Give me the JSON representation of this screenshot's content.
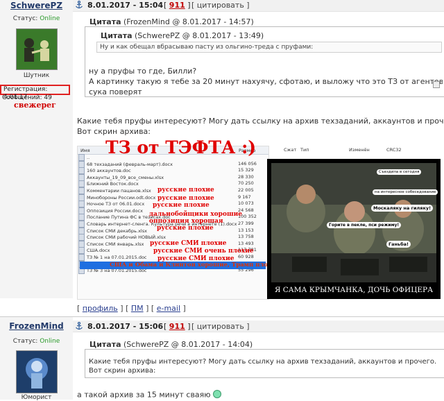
{
  "post1": {
    "username": "SchwerePZ",
    "status_label": "Статус:",
    "status_value": "Online",
    "rank": "Шутник",
    "reg_label": "Регистрация: 4.01.17",
    "messages_label": "Сообщений: 49",
    "badge": "свежерег",
    "date": "8.01.2017 - 15:04",
    "open_bracket": "[",
    "post_number": "911",
    "close_bracket": "]",
    "quote_action": "[ цитировать ]",
    "outer_quote": {
      "author_label": "Цитата",
      "author_meta": "(FrozenMind @ 8.01.2017 - 14:57)"
    },
    "inner_quote": {
      "author_label": "Цитата",
      "author_meta": "(SchwerePZ @ 8.01.2017 - 13:49)",
      "text": "Ну и как обещал вбрасываю пасту из ольгино-треда с пруфами:"
    },
    "outer_quote_lines": [
      "ну а пруфы то где, Билли?",
      "А картинку такую я тебе за 20 минут нахуячу, сфотаю, и выложу что это ТЗ от агентов ЦРУ. И мне поверят.",
      "сука поверят"
    ],
    "body_lines": [
      "Какие тебя пруфы интересуют? Могу дать ссылку на архив техзаданий, аккаунтов и прочего.",
      "Вот скрин архива:"
    ],
    "footer": {
      "profile": "профиль",
      "pm": "ПМ",
      "email": "e-mail"
    }
  },
  "screenshot": {
    "columns": [
      "Имя",
      "Размер",
      "Сжат",
      "Тип",
      "Изменён",
      "CRC32"
    ],
    "title_overlay": "ТЗ от ТЭФТА :)",
    "files": [
      {
        "name": "..",
        "size": ""
      },
      {
        "name": "68 техзаданий (февраль-март).docx",
        "size": "146 056"
      },
      {
        "name": "160 аккаунтов.doc",
        "size": "15 329"
      },
      {
        "name": "Аккаунты_19_09_все_смены.xlsx",
        "size": "28 330"
      },
      {
        "name": "Ближний Восток.docx",
        "size": "70 250"
      },
      {
        "name": "Комментарии пацанов.xlsx",
        "size": "22 005"
      },
      {
        "name": "Минобороны России.odt.docx",
        "size": "9 167"
      },
      {
        "name": "Ночное ТЗ от 06.01.docx",
        "size": "10 073"
      },
      {
        "name": "Оппозиция России.docx",
        "size": "24 568"
      },
      {
        "name": "Послание Путина ФС в тезисах.doc",
        "size": "100 352"
      },
      {
        "name": "Словарь интернет-сленга. Культура речи в интернете (1).docx",
        "size": "27 399"
      },
      {
        "name": "Список СМИ декабрь.xlsx",
        "size": "13 153"
      },
      {
        "name": "Список СМИ рабочий НОВЫЙ.xlsx",
        "size": "13 758"
      },
      {
        "name": "Список СМИ январь.xlsx",
        "size": "13 493"
      },
      {
        "name": "США.docx",
        "size": "117 781"
      },
      {
        "name": "ТЗ № 1 на 07.01.2015.doc",
        "size": "60 928"
      },
      {
        "name": "ТЗ № 2 на 07.01.2015.doc",
        "size": "61 952"
      },
      {
        "name": "ТЗ № 3 на 07.01.2015.doc",
        "size": "55 296"
      }
    ],
    "annotations": [
      "русские плохие",
      "русские плохие",
      "русские плохие",
      "дальнобойщики хорошие",
      "оппозиция хорошая",
      "русские плохие",
      "русские СМИ плохие",
      "русские СМИ очень плохие",
      "русские СМИ плохие",
      "США и Обама и Клинтон хорошие, Трамп плохой"
    ]
  },
  "meme": {
    "bubbles": [
      "Съездила в сегодня",
      "на интересное собеседование",
      "Москаляку на гиляку!",
      "Горите в пекле, пси режиму!",
      "Ганьба!"
    ],
    "caption": "Я САМА КРЫМЧАНКА, ДОЧЬ ОФИЦЕРА"
  },
  "post2": {
    "username": "FrozenMind",
    "status_label": "Статус:",
    "status_value": "Online",
    "rank": "Юморист",
    "date": "8.01.2017 - 15:06",
    "open_bracket": "[",
    "post_number": "911",
    "close_bracket": "]",
    "quote_action": "[ цитировать ]",
    "quote": {
      "author_label": "Цитата",
      "author_meta": "(SchwerePZ @ 8.01.2017 - 14:04)",
      "lines": [
        "Какие тебя пруфы интересуют? Могу дать ссылку на архив техзаданий, аккаунтов и прочего.",
        "Вот скрин архива:"
      ]
    },
    "body_text": "а такой архив за 15 минут сваяю"
  },
  "colors": {
    "online": "#2a9a2a",
    "link": "#2a3f8f",
    "annotation": "#e00000",
    "highlight": "#1f6fe0"
  },
  "icons": {
    "post_anchor": "anchor-icon",
    "smiley": "smiley-icon"
  }
}
